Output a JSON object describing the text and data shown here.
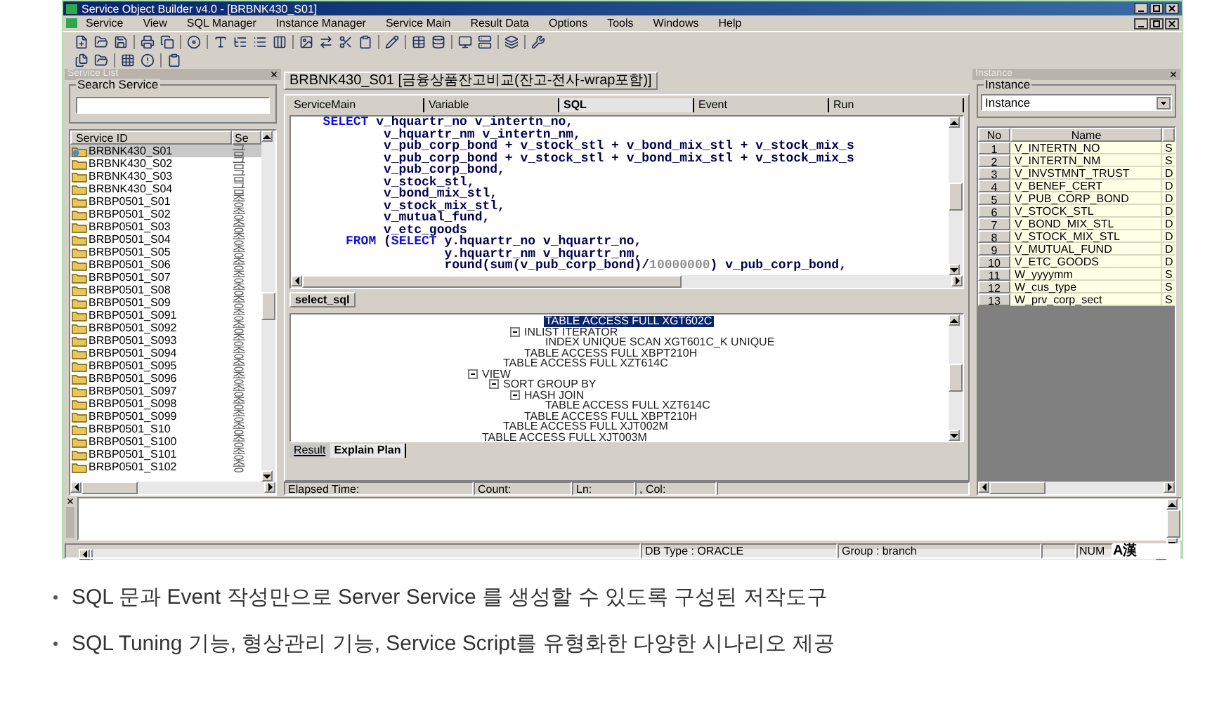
{
  "window": {
    "title": "Service Object Builder v4.0 - [BRBNK430_S01]"
  },
  "menu": [
    "Service",
    "View",
    "SQL Manager",
    "Instance Manager",
    "Service Main",
    "Result Data",
    "Options",
    "Tools",
    "Windows",
    "Help"
  ],
  "service_list": {
    "title": "Service List",
    "search_label": "Search Service",
    "columns": [
      "Service ID",
      "Se"
    ],
    "rows": [
      {
        "id": "BRBNK430_S01",
        "col2": "금",
        "selected": true
      },
      {
        "id": "BRBNK430_S02",
        "col2": "금",
        "selected": false
      },
      {
        "id": "BRBNK430_S03",
        "col2": "금",
        "selected": false
      },
      {
        "id": "BRBNK430_S04",
        "col2": "금",
        "selected": false
      },
      {
        "id": "BRBP0501_S01",
        "col2": "종",
        "selected": false
      },
      {
        "id": "BRBP0501_S02",
        "col2": "종",
        "selected": false
      },
      {
        "id": "BRBP0501_S03",
        "col2": "종",
        "selected": false
      },
      {
        "id": "BRBP0501_S04",
        "col2": "종",
        "selected": false
      },
      {
        "id": "BRBP0501_S05",
        "col2": "종",
        "selected": false
      },
      {
        "id": "BRBP0501_S06",
        "col2": "종",
        "selected": false
      },
      {
        "id": "BRBP0501_S07",
        "col2": "종",
        "selected": false
      },
      {
        "id": "BRBP0501_S08",
        "col2": "종",
        "selected": false
      },
      {
        "id": "BRBP0501_S09",
        "col2": "종",
        "selected": false
      },
      {
        "id": "BRBP0501_S091",
        "col2": "종",
        "selected": false
      },
      {
        "id": "BRBP0501_S092",
        "col2": "종",
        "selected": false
      },
      {
        "id": "BRBP0501_S093",
        "col2": "종",
        "selected": false
      },
      {
        "id": "BRBP0501_S094",
        "col2": "종",
        "selected": false
      },
      {
        "id": "BRBP0501_S095",
        "col2": "종",
        "selected": false
      },
      {
        "id": "BRBP0501_S096",
        "col2": "종",
        "selected": false
      },
      {
        "id": "BRBP0501_S097",
        "col2": "종",
        "selected": false
      },
      {
        "id": "BRBP0501_S098",
        "col2": "종",
        "selected": false
      },
      {
        "id": "BRBP0501_S099",
        "col2": "종",
        "selected": false
      },
      {
        "id": "BRBP0501_S10",
        "col2": "종",
        "selected": false
      },
      {
        "id": "BRBP0501_S100",
        "col2": "종",
        "selected": false
      },
      {
        "id": "BRBP0501_S101",
        "col2": "종",
        "selected": false
      },
      {
        "id": "BRBP0501_S102",
        "col2": "종",
        "selected": false
      }
    ]
  },
  "document": {
    "title": "BRBNK430_S01 [금융상품잔고비교(잔고-전사-wrap포함)]",
    "tabs": [
      {
        "label": "ServiceMain",
        "selected": false
      },
      {
        "label": "Variable",
        "selected": false
      },
      {
        "label": "SQL",
        "selected": true
      },
      {
        "label": "Event",
        "selected": false
      },
      {
        "label": "Run",
        "selected": false
      }
    ],
    "sql_lines": [
      [
        {
          "kind": "keyword",
          "text": "  SELECT"
        },
        {
          "kind": "plain",
          "text": " v_hquartr_no v_intertn_no,"
        }
      ],
      [
        {
          "kind": "plain",
          "text": "          v_hquartr_nm v_intertn_nm,"
        }
      ],
      [
        {
          "kind": "plain",
          "text": "          v_pub_corp_bond + v_stock_stl + v_bond_mix_stl + v_stock_mix_s"
        }
      ],
      [
        {
          "kind": "plain",
          "text": "          v_pub_corp_bond + v_stock_stl + v_bond_mix_stl + v_stock_mix_s"
        }
      ],
      [
        {
          "kind": "plain",
          "text": "          v_pub_corp_bond,"
        }
      ],
      [
        {
          "kind": "plain",
          "text": "          v_stock_stl,"
        }
      ],
      [
        {
          "kind": "plain",
          "text": "          v_bond_mix_stl,"
        }
      ],
      [
        {
          "kind": "plain",
          "text": "          v_stock_mix_stl,"
        }
      ],
      [
        {
          "kind": "plain",
          "text": "          v_mutual_fund,"
        }
      ],
      [
        {
          "kind": "plain",
          "text": "          v_etc_goods"
        }
      ],
      [
        {
          "kind": "keyword",
          "text": "     FROM"
        },
        {
          "kind": "plain",
          "text": " ("
        },
        {
          "kind": "keyword",
          "text": "SELECT"
        },
        {
          "kind": "plain",
          "text": " y.hquartr_no v_hquartr_no,"
        }
      ],
      [
        {
          "kind": "plain",
          "text": "                  y.hquartr_nm v_hquartr_nm,"
        }
      ],
      [
        {
          "kind": "plain",
          "text": "                  round(sum(v_pub_corp_bond)/"
        },
        {
          "kind": "number",
          "text": "10000000"
        },
        {
          "kind": "plain",
          "text": ") v_pub_corp_bond,"
        }
      ]
    ],
    "query_tabs": [
      {
        "label": "select_sql",
        "selected": true
      }
    ],
    "plan": [
      {
        "children": [
          {
            "children": [
              {
                "children": [
                  {
                    "label": "TABLE ACCESS FULL XGT602C",
                    "selected": true
                  }
                ]
              },
              {
                "label": "INLIST ITERATOR",
                "selected": false,
                "expanded": true,
                "children": [
                  {
                    "label": "INDEX UNIQUE SCAN XGT601C_K UNIQUE",
                    "selected": false
                  }
                ]
              },
              {
                "label": "TABLE ACCESS FULL XBPT210H",
                "selected": false
              }
            ]
          },
          {
            "label": "TABLE ACCESS FULL XZT614C",
            "selected": false
          }
        ]
      },
      {
        "label": "VIEW",
        "selected": false,
        "expanded": true,
        "children": [
          {
            "label": "SORT GROUP BY",
            "selected": false,
            "expanded": true,
            "children": [
              {
                "label": "HASH JOIN",
                "selected": false,
                "expanded": true,
                "children": [
                  {
                    "label": "TABLE ACCESS FULL XZT614C",
                    "selected": false
                  }
                ]
              },
              {
                "label": "TABLE ACCESS FULL XBPT210H",
                "selected": false
              }
            ]
          },
          {
            "label": "TABLE ACCESS FULL XJT002M",
            "selected": false
          }
        ]
      },
      {
        "label": "TABLE ACCESS FULL XJT003M",
        "selected": false
      }
    ],
    "result_tabs": [
      {
        "label": "Result",
        "selected": false
      },
      {
        "label": "Explain Plan",
        "selected": true
      }
    ],
    "status": [
      "Elapsed Time:",
      "Count:",
      "Ln:",
      ", Col:"
    ]
  },
  "instance": {
    "title": "Instance",
    "group_label": "Instance",
    "combo_value": "Instance",
    "columns": [
      "No",
      "Name"
    ],
    "rows": [
      {
        "no": "1",
        "name": "V_INTERTN_NO",
        "col3": "S"
      },
      {
        "no": "2",
        "name": "V_INTERTN_NM",
        "col3": "S"
      },
      {
        "no": "3",
        "name": "V_INVSTMNT_TRUST",
        "col3": "D"
      },
      {
        "no": "4",
        "name": "V_BENEF_CERT",
        "col3": "D"
      },
      {
        "no": "5",
        "name": "V_PUB_CORP_BOND",
        "col3": "D"
      },
      {
        "no": "6",
        "name": "V_STOCK_STL",
        "col3": "D"
      },
      {
        "no": "7",
        "name": "V_BOND_MIX_STL",
        "col3": "D"
      },
      {
        "no": "8",
        "name": "V_STOCK_MIX_STL",
        "col3": "D"
      },
      {
        "no": "9",
        "name": "V_MUTUAL_FUND",
        "col3": "D"
      },
      {
        "no": "10",
        "name": "V_ETC_GOODS",
        "col3": "D"
      },
      {
        "no": "11",
        "name": "W_yyyymm",
        "col3": "S"
      },
      {
        "no": "12",
        "name": "W_cus_type",
        "col3": "S"
      },
      {
        "no": "13",
        "name": "W_prv_corp_sect",
        "col3": "S"
      }
    ]
  },
  "status_bar": {
    "db_type": "DB Type : ORACLE",
    "group": "Group : branch",
    "num": "NUM",
    "ime": "A漢"
  },
  "bullets": [
    "SQL 문과 Event 작성만으로 Server Service 를 생성할 수 있도록 구성된 저작도구",
    "SQL Tuning 기능, 형상관리 기능, Service Script를 유형화한 다양한 시나리오 제공"
  ]
}
